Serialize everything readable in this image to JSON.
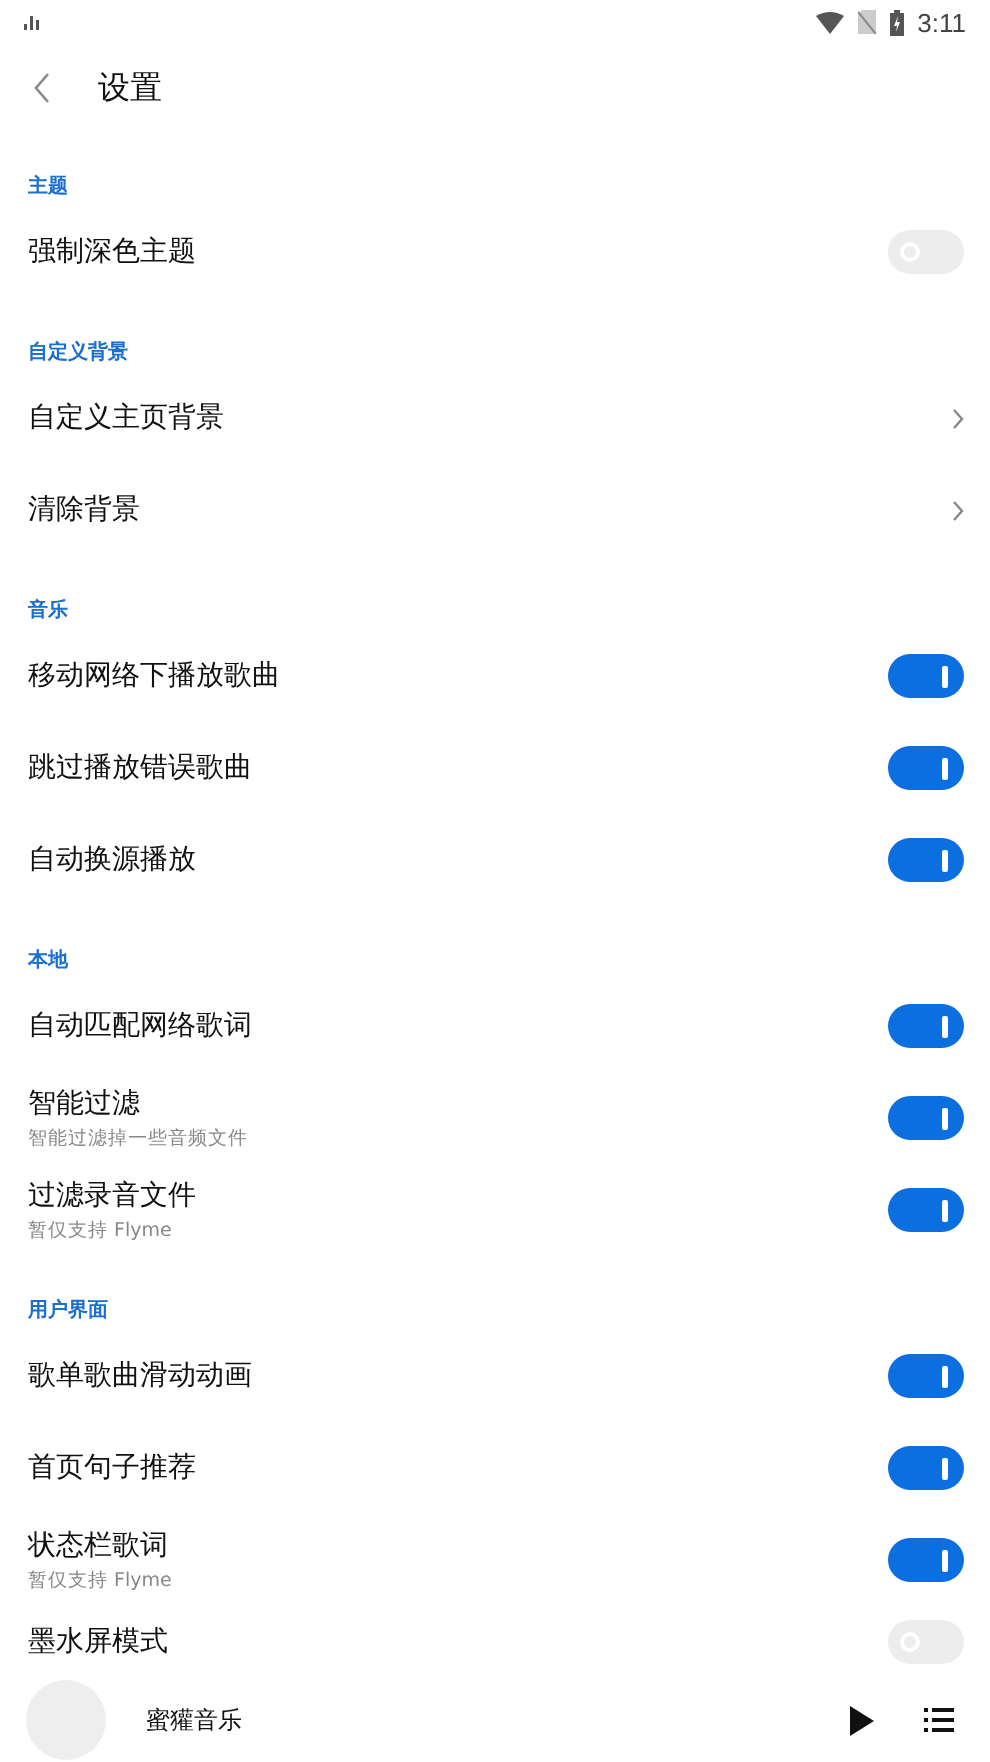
{
  "status_bar": {
    "time": "3:11"
  },
  "header": {
    "title": "设置"
  },
  "sections": [
    {
      "title": "主题",
      "items": [
        {
          "kind": "switch",
          "label": "强制深色主题",
          "on": false
        }
      ]
    },
    {
      "title": "自定义背景",
      "items": [
        {
          "kind": "link",
          "label": "自定义主页背景"
        },
        {
          "kind": "link",
          "label": "清除背景"
        }
      ]
    },
    {
      "title": "音乐",
      "items": [
        {
          "kind": "switch",
          "label": "移动网络下播放歌曲",
          "on": true
        },
        {
          "kind": "switch",
          "label": "跳过播放错误歌曲",
          "on": true
        },
        {
          "kind": "switch",
          "label": "自动换源播放",
          "on": true
        }
      ]
    },
    {
      "title": "本地",
      "items": [
        {
          "kind": "switch",
          "label": "自动匹配网络歌词",
          "on": true
        },
        {
          "kind": "switch",
          "label": "智能过滤",
          "subtitle": "智能过滤掉一些音频文件",
          "on": true
        },
        {
          "kind": "switch",
          "label": "过滤录音文件",
          "subtitle": "暂仅支持 Flyme",
          "on": true
        }
      ]
    },
    {
      "title": "用户界面",
      "items": [
        {
          "kind": "switch",
          "label": "歌单歌曲滑动动画",
          "on": true
        },
        {
          "kind": "switch",
          "label": "首页句子推荐",
          "on": true
        },
        {
          "kind": "switch",
          "label": "状态栏歌词",
          "subtitle": "暂仅支持 Flyme",
          "on": true
        },
        {
          "kind": "switch",
          "label": "墨水屏模式",
          "on": false
        }
      ]
    }
  ],
  "player": {
    "title": "蜜獾音乐"
  }
}
